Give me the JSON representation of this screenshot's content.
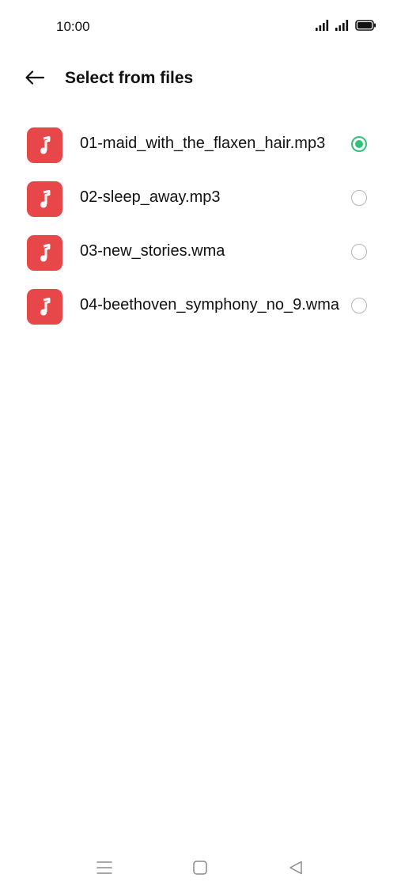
{
  "status_bar": {
    "time": "10:00",
    "icons": [
      "signal-icon",
      "signal-icon",
      "battery-icon"
    ]
  },
  "header": {
    "title": "Select from files",
    "back_icon": "arrow-left-icon"
  },
  "files": [
    {
      "name": "01-maid_with_the_flaxen_hair.mp3",
      "icon": "music-note-icon",
      "selected": true
    },
    {
      "name": "02-sleep_away.mp3",
      "icon": "music-note-icon",
      "selected": false
    },
    {
      "name": "03-new_stories.wma",
      "icon": "music-note-icon",
      "selected": false
    },
    {
      "name": "04-beethoven_symphony_no_9.wma",
      "icon": "music-note-icon",
      "selected": false
    }
  ],
  "nav_bar": {
    "icons": [
      "menu-icon",
      "home-square-icon",
      "back-triangle-icon"
    ]
  },
  "colors": {
    "file_icon_bg": "#e8474a",
    "radio_selected": "#2fc37a",
    "radio_unselected": "#b5b5b5"
  }
}
